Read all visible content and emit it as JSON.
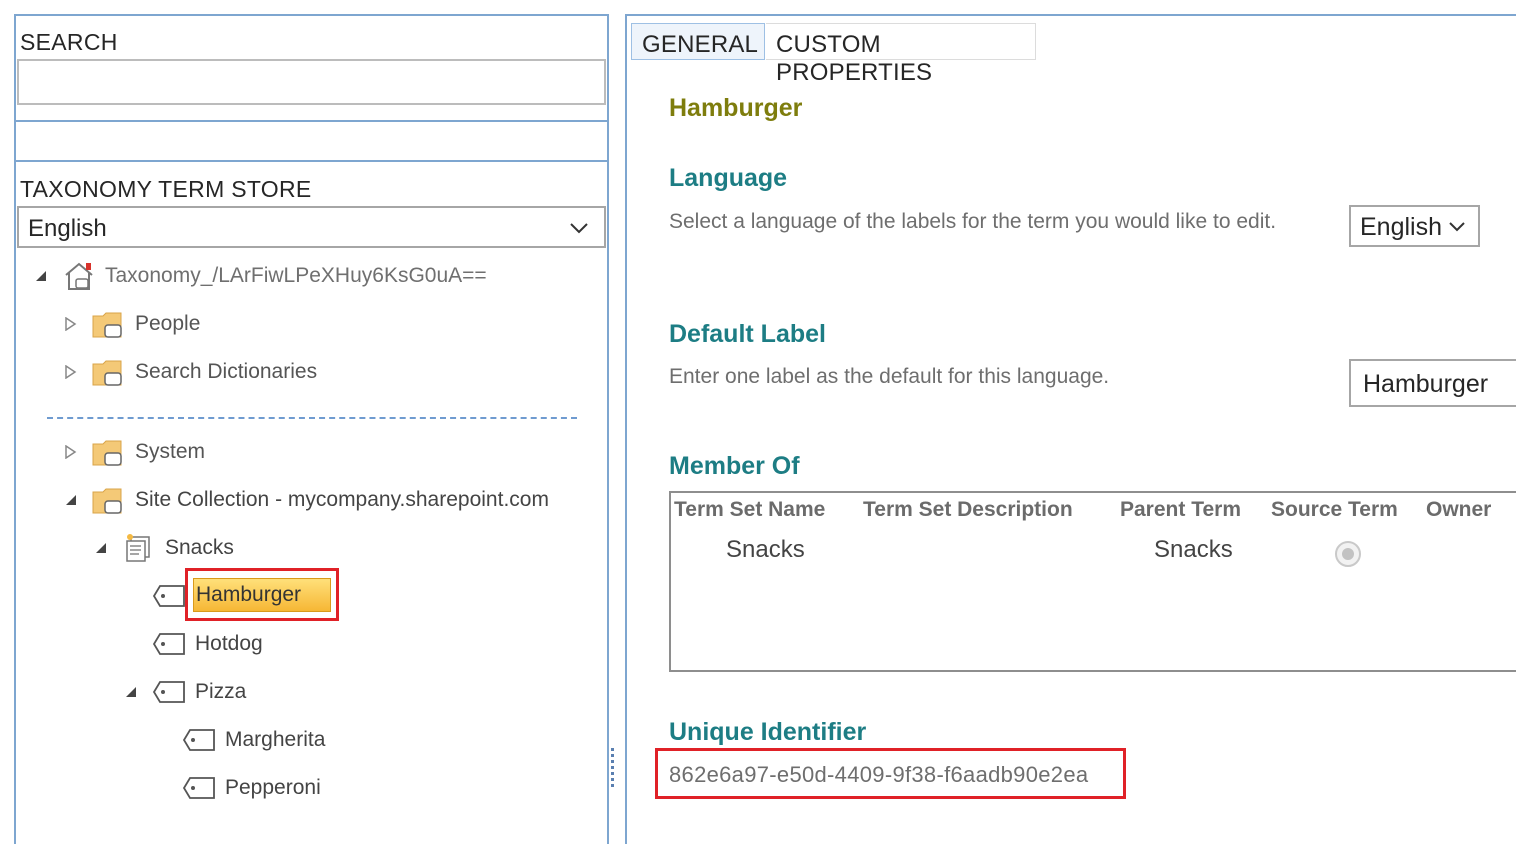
{
  "left": {
    "search_heading": "SEARCH",
    "search_value": "",
    "termstore_heading": "TAXONOMY TERM STORE",
    "language_selected": "English",
    "tree": {
      "root": "Taxonomy_/LArFiwLPeXHuy6KsG0uA==",
      "people": "People",
      "search_dictionaries": "Search Dictionaries",
      "system": "System",
      "site_collection": "Site Collection - mycompany.sharepoint.com",
      "snacks": "Snacks",
      "hamburger": "Hamburger",
      "hotdog": "Hotdog",
      "pizza": "Pizza",
      "margherita": "Margherita",
      "pepperoni": "Pepperoni"
    }
  },
  "right": {
    "tabs": [
      "GENERAL",
      "CUSTOM PROPERTIES"
    ],
    "active_tab": "GENERAL",
    "term_title": "Hamburger",
    "language": {
      "title": "Language",
      "description": "Select a language of the labels for the term you would like to edit.",
      "selected": "English"
    },
    "default_label": {
      "title": "Default Label",
      "description": "Enter one label as the default for this language.",
      "value": "Hamburger"
    },
    "member_of": {
      "title": "Member Of",
      "columns": [
        "Term Set Name",
        "Term Set Description",
        "Parent Term",
        "Source Term",
        "Owner"
      ],
      "rows": [
        {
          "term_set_name": "Snacks",
          "term_set_description": "",
          "parent_term": "Snacks",
          "source_term": true,
          "owner": ""
        }
      ]
    },
    "unique_identifier": {
      "title": "Unique Identifier",
      "value": "862e6a97-e50d-4409-9f38-f6aadb90e2ea"
    }
  },
  "colors": {
    "pane_border": "#7ea6d0",
    "section_title": "#1d7d84",
    "term_title": "#7e7d0d",
    "highlight_box": "#e02127",
    "selected_term": "#f6b735"
  },
  "icons": {
    "root": "site-home-icon",
    "group": "folder-tag-icon",
    "term_set": "term-set-icon",
    "term": "tag-icon"
  }
}
